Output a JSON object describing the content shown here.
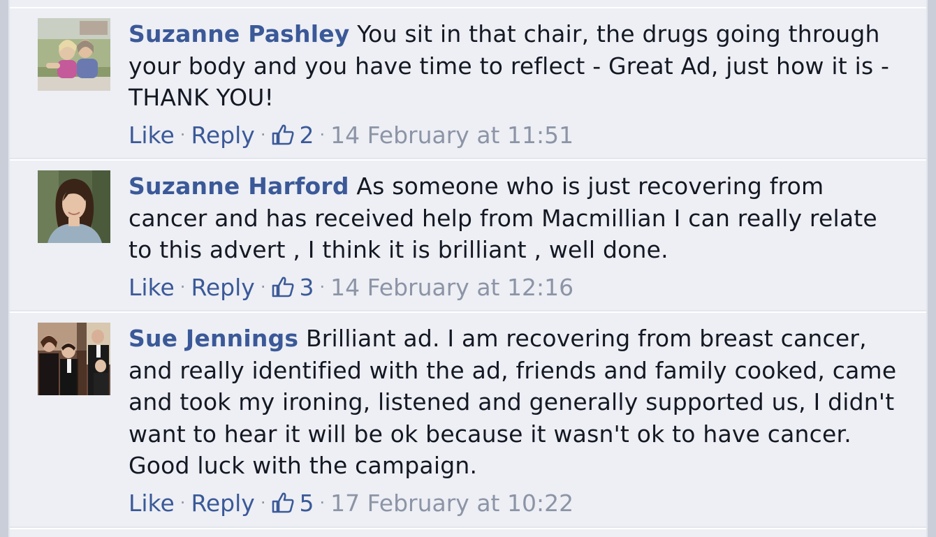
{
  "comments": [
    {
      "author": "Suzanne Pashley",
      "text": "You sit in that chair, the drugs going through your body and you have time to reflect - Great Ad, just how it is - THANK YOU!",
      "like_label": "Like",
      "reply_label": "Reply",
      "likes": "2",
      "timestamp": "14 February at 11:51",
      "avatar_icon": "profile-photo-two-women"
    },
    {
      "author": "Suzanne Harford",
      "text": "As someone who is just recovering from cancer and has received help from Macmillian I can really relate to this advert , I think it is brilliant , well done.",
      "like_label": "Like",
      "reply_label": "Reply",
      "likes": "3",
      "timestamp": "14 February at 12:16",
      "avatar_icon": "profile-photo-woman"
    },
    {
      "author": "Sue Jennings",
      "text": "Brilliant ad. I am recovering from breast cancer, and really identified with the ad, friends and family cooked, came and took my ironing, listened and generally supported us, I didn't want to hear it will be ok because it wasn't ok to have cancer. Good luck with the campaign.",
      "like_label": "Like",
      "reply_label": "Reply",
      "likes": "5",
      "timestamp": "17 February at 10:22",
      "avatar_icon": "profile-photo-family"
    }
  ],
  "colors": {
    "link": "#3b5998",
    "meta_gray": "#8c94a6",
    "comment_bg": "#edeff4"
  }
}
